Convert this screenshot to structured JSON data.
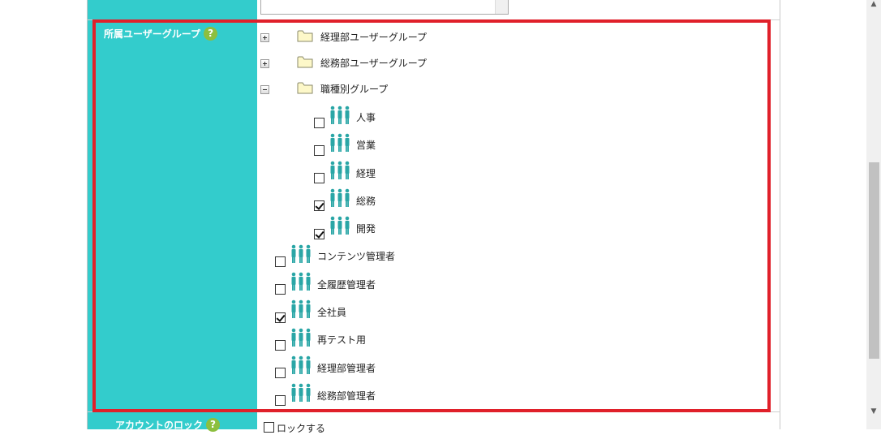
{
  "group_row": {
    "label": "所属ユーザーグループ",
    "help": "?"
  },
  "lock_row": {
    "label": "アカウントのロック",
    "help": "?",
    "checkbox_label": "ロックする"
  },
  "tree": {
    "folders": [
      {
        "label": "経理部ユーザーグループ",
        "expanded": false
      },
      {
        "label": "総務部ユーザーグループ",
        "expanded": false
      },
      {
        "label": "職種別グループ",
        "expanded": true
      }
    ],
    "subgroups": [
      {
        "label": "人事",
        "checked": false
      },
      {
        "label": "営業",
        "checked": false
      },
      {
        "label": "経理",
        "checked": false
      },
      {
        "label": "総務",
        "checked": true
      },
      {
        "label": "開発",
        "checked": true
      }
    ],
    "groups": [
      {
        "label": "コンテンツ管理者",
        "checked": false
      },
      {
        "label": "全履歴管理者",
        "checked": false
      },
      {
        "label": "全社員",
        "checked": true
      },
      {
        "label": "再テスト用",
        "checked": false
      },
      {
        "label": "経理部管理者",
        "checked": false
      },
      {
        "label": "総務部管理者",
        "checked": false
      }
    ]
  },
  "colors": {
    "label_bg": "#33cccc",
    "highlight": "#e0202a",
    "help_icon": "#8cbf3f",
    "people_icon": "#2aa6a6"
  },
  "icons": {
    "expand": "plus-box-icon",
    "collapse": "minus-box-icon",
    "folder": "folder-icon",
    "group": "people-group-icon",
    "help": "help-icon"
  }
}
